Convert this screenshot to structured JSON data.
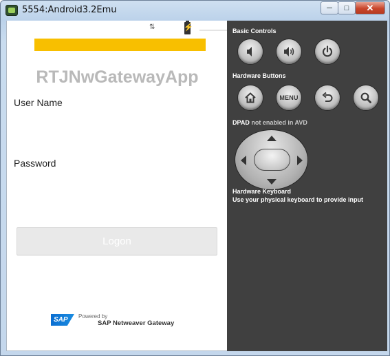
{
  "window": {
    "title": "5554:Android3.2Emu",
    "minimize_glyph": "─",
    "maximize_glyph": "□",
    "close_glyph": "✕"
  },
  "statusbar": {
    "sync_glyph": "⇅"
  },
  "app": {
    "title": "RTJNwGatewayApp",
    "username_label": "User Name",
    "password_label": "Password",
    "logon_label": "Logon",
    "username_value": "",
    "password_value": ""
  },
  "footer": {
    "sap_logo_text": "SAP",
    "powered_by": "Powered by",
    "product": "SAP Netweaver Gateway"
  },
  "panel": {
    "basic_controls": "Basic Controls",
    "hardware_buttons": "Hardware Buttons",
    "menu_label": "MENU",
    "dpad_label": "DPAD",
    "dpad_note": "not enabled in AVD",
    "keyboard_title": "Hardware Keyboard",
    "keyboard_desc": "Use your physical keyboard to provide input"
  },
  "colors": {
    "accent_bar": "#f8bf00",
    "panel_bg": "#404040",
    "title_gray": "#b9b9b9"
  },
  "icons": [
    "volume-down-icon",
    "volume-up-icon",
    "power-icon",
    "home-icon",
    "back-icon",
    "search-icon",
    "battery-icon",
    "sync-icon"
  ]
}
